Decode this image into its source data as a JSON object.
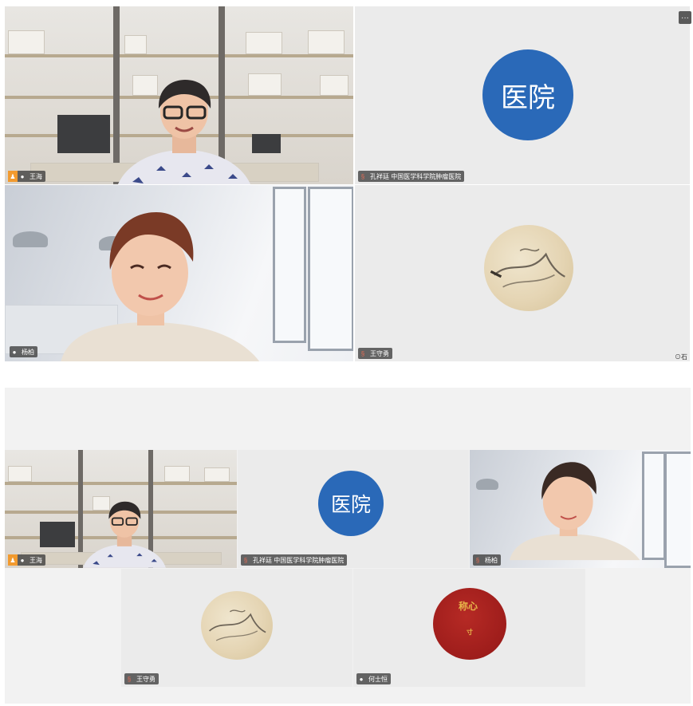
{
  "top_grid": {
    "tile1": {
      "name": "王海"
    },
    "tile2": {
      "logo_text": "医院",
      "name": "孔祥廷 中国医学科学院肿瘤医院",
      "more": "···"
    },
    "tile3": {
      "name": "杨柏"
    },
    "tile4": {
      "name": "王守勇",
      "corner": "⊙石"
    }
  },
  "bottom_grid": {
    "tile1": {
      "name": "王海"
    },
    "tile2": {
      "logo_text": "医院",
      "name": "孔祥廷 中国医学科学院肿瘤医院"
    },
    "tile3": {
      "name": "杨柏"
    },
    "tile4": {
      "name": "王守勇"
    },
    "tile5": {
      "name": "何士恒",
      "avatar_text": "称心",
      "avatar_sub": "寸"
    }
  }
}
